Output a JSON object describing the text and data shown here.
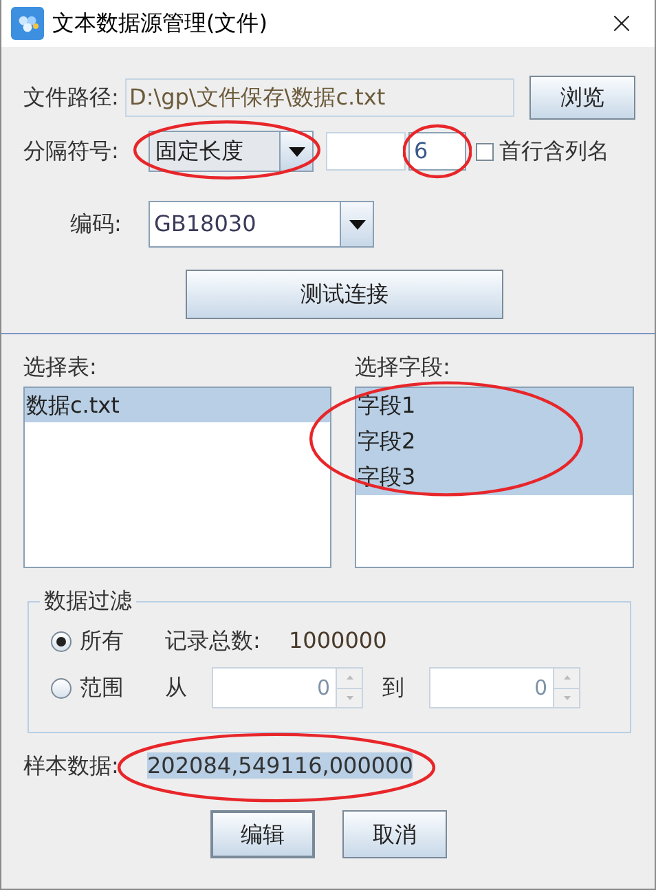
{
  "window": {
    "title": "文本数据源管理(文件)"
  },
  "file_path": {
    "label": "文件路径:",
    "value": "D:\\gp\\文件保存\\数据c.txt"
  },
  "browse_button": "浏览",
  "separator": {
    "label": "分隔符号:",
    "value": "固定长度",
    "highlighted": true
  },
  "length": {
    "value": "6",
    "highlighted": true
  },
  "header_checkbox": {
    "label": "首行含列名",
    "checked": false
  },
  "encoding": {
    "label": "编码:",
    "value": "GB18030"
  },
  "test_button": "测试连接",
  "tables": {
    "label": "选择表:",
    "items": [
      {
        "label": "数据c.txt",
        "selected": true
      }
    ]
  },
  "fields": {
    "label": "选择字段:",
    "highlighted": true,
    "items": [
      {
        "label": "字段1",
        "selected": true
      },
      {
        "label": "字段2",
        "selected": true
      },
      {
        "label": "字段3",
        "selected": true
      }
    ]
  },
  "filter": {
    "title": "数据过滤",
    "options": [
      {
        "label": "所有",
        "selected": true
      },
      {
        "label": "范围",
        "selected": false
      }
    ],
    "record_count": {
      "label": "记录总数:",
      "value": "1000000"
    },
    "from": {
      "label": "从",
      "value": "0"
    },
    "to": {
      "label": "到",
      "value": "0"
    }
  },
  "sample": {
    "label": "样本数据:",
    "value": "202084,549116,000000",
    "highlighted": true
  },
  "buttons": [
    {
      "label": "编辑",
      "selected": true
    },
    {
      "label": "取消",
      "selected": false
    }
  ]
}
